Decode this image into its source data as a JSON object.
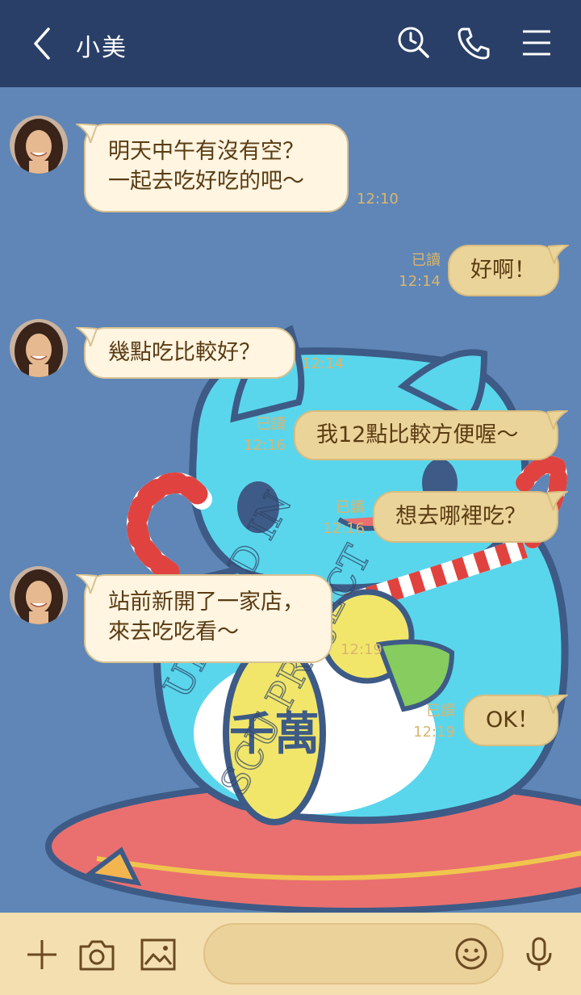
{
  "header": {
    "contact_name": "小美",
    "back_icon": "chevron-left-icon",
    "search_icon": "search-icon",
    "call_icon": "phone-icon",
    "menu_icon": "menu-icon"
  },
  "colors": {
    "header_bg": "#293f67",
    "chat_bg": "#5f86b6",
    "incoming_bubble": "#fff5e1",
    "outgoing_bubble": "#ebd49a",
    "meta_text": "#d9b56f",
    "input_bar": "#f3dfb0"
  },
  "messages": [
    {
      "direction": "in",
      "lines": [
        "明天中午有沒有空？",
        "一起去吃好吃的吧～"
      ],
      "time": "12:10"
    },
    {
      "direction": "out",
      "lines": [
        "好啊！"
      ],
      "read": "已讀",
      "time": "12:14"
    },
    {
      "direction": "in",
      "lines": [
        "幾點吃比較好？"
      ],
      "time": "12:14"
    },
    {
      "direction": "out",
      "lines": [
        "我12點比較方便喔～"
      ],
      "read": "已讀",
      "time": "12:16"
    },
    {
      "direction": "out",
      "lines": [
        "想去哪裡吃？"
      ],
      "read": "已讀",
      "time": "12:16"
    },
    {
      "direction": "in",
      "lines": [
        "站前新開了一家店，",
        "來去吃吃看～"
      ],
      "time": "12:19"
    },
    {
      "direction": "out",
      "lines": [
        "OK！"
      ],
      "read": "已讀",
      "time": "12:19"
    }
  ],
  "background_watermark": "UPLOAD IN SCU PROJECT",
  "background_badge_text": "千萬",
  "input_bar": {
    "add_icon": "plus-icon",
    "camera_icon": "camera-icon",
    "image_icon": "image-icon",
    "message_placeholder": "",
    "emoji_icon": "emoji-icon",
    "mic_icon": "microphone-icon"
  }
}
